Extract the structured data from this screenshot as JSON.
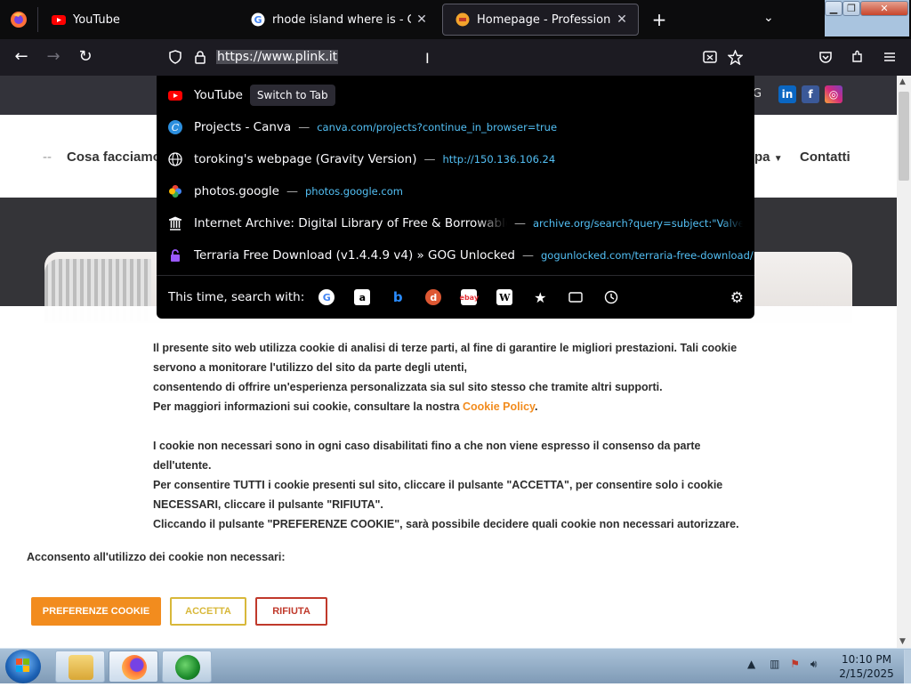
{
  "browser": {
    "tabs": [
      {
        "title": "YouTube",
        "icon": "youtube-icon",
        "active": false
      },
      {
        "title": "rhode island where is - Google",
        "icon": "google-icon",
        "active": false
      },
      {
        "title": "Homepage - Professional Link",
        "icon": "plink-icon",
        "active": true
      }
    ],
    "new_tab_label": "+",
    "url": "https://www.plink.it",
    "window_controls": {
      "minimize": "▁",
      "maximize": "❐",
      "close": "✕"
    }
  },
  "url_dropdown": {
    "suggestions": [
      {
        "title": "YouTube",
        "url": "",
        "action": "Switch to Tab",
        "icon": "youtube-icon"
      },
      {
        "title": "Projects - Canva",
        "url": "canva.com/projects?continue_in_browser=true",
        "action": "",
        "icon": "canva-icon"
      },
      {
        "title": "toroking's webpage (Gravity Version)",
        "url": "http://150.136.106.24",
        "action": "",
        "icon": "globe-icon"
      },
      {
        "title": "photos.google",
        "url": "photos.google.com",
        "action": "",
        "icon": "google-photos-icon"
      },
      {
        "title": "Internet Archive: Digital Library of Free & Borrowable Tex",
        "url": "archive.org/search?query=subject:\"Valve+Co",
        "action": "",
        "icon": "archive-icon"
      },
      {
        "title": "Terraria Free Download (v1.4.4.9 v4) » GOG Unlocked",
        "url": "gogunlocked.com/terraria-free-download/",
        "action": "",
        "icon": "lock-icon"
      }
    ],
    "search_with_label": "This time, search with:",
    "engines": [
      "google-icon",
      "amazon-icon",
      "bing-icon",
      "duckduckgo-icon",
      "ebay-icon",
      "wikipedia-icon",
      "bookmarks-icon",
      "tabs-icon",
      "history-icon"
    ]
  },
  "site": {
    "top_letter": "G",
    "social": [
      "in",
      "f",
      "◎"
    ],
    "menu": {
      "dash": "--",
      "cosa": "Cosa facciamo",
      "mappa": "pa",
      "contatti": "Contatti"
    }
  },
  "cookie": {
    "para1_line1": "Il presente sito web utilizza cookie di analisi di terze parti, al fine di garantire le migliori prestazioni. Tali cookie servono a monitorare l'utilizzo del sito da parte degli utenti,",
    "para1_line2": "consentendo di offrire un'esperienza personalizzata sia sul sito stesso che tramite altri supporti.",
    "para1_line3_prefix": "Per maggiori informazioni sui cookie, consultare la nostra ",
    "policy_link": "Cookie Policy",
    "para1_line3_suffix": ".",
    "para2_line1": "I cookie non necessari sono in ogni caso disabilitati fino a che non viene espresso il consenso da parte dell'utente.",
    "para2_line2": "Per consentire TUTTI i cookie presenti sul sito, cliccare il pulsante \"ACCETTA\", per consentire solo i cookie NECESSARI, cliccare il pulsante \"RIFIUTA\".",
    "para2_line3": "Cliccando il pulsante \"PREFERENZE COOKIE\", sarà possibile decidere quali cookie non necessari autorizzare.",
    "consent_label": "Acconsento all'utilizzo dei cookie non necessari:",
    "buttons": {
      "preferences": "PREFERENZE COOKIE",
      "accept": "ACCETTA",
      "refuse": "RIFIUTA"
    },
    "colors": {
      "orange": "#f28c1e",
      "gold": "#d8b83a",
      "red": "#c0392b"
    }
  },
  "taskbar": {
    "time": "10:10 PM",
    "date": "2/15/2025"
  }
}
